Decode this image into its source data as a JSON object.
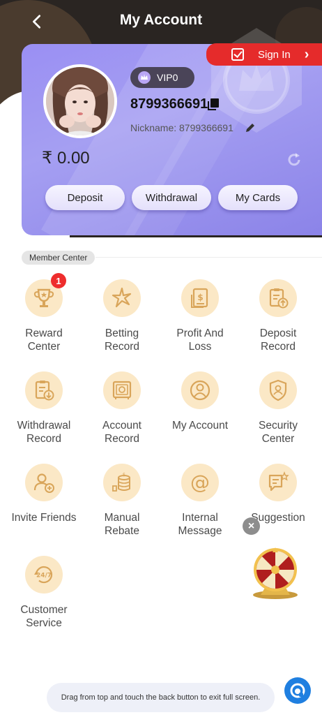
{
  "header": {
    "title": "My Account",
    "back_icon": "chevron-left-icon"
  },
  "profile": {
    "sign_in_label": "Sign In",
    "vip_label": "VIP0",
    "account_id": "8799366691",
    "nickname": "Nickname: 8799366691",
    "balance": "₹ 0.00"
  },
  "actions": [
    {
      "label": "Deposit"
    },
    {
      "label": "Withdrawal"
    },
    {
      "label": "My Cards"
    }
  ],
  "member_center": {
    "label": "Member Center",
    "items": [
      {
        "label_line1": "Reward",
        "label_line2": "Center",
        "icon": "trophy-icon",
        "badge": "1"
      },
      {
        "label_line1": "Betting",
        "label_line2": "Record",
        "icon": "betting-icon"
      },
      {
        "label_line1": "Profit And",
        "label_line2": "Loss",
        "icon": "document-dollar-icon"
      },
      {
        "label_line1": "Deposit",
        "label_line2": "Record",
        "icon": "clipboard-upload-icon"
      },
      {
        "label_line1": "Withdrawal",
        "label_line2": "Record",
        "icon": "clipboard-download-icon"
      },
      {
        "label_line1": "Account",
        "label_line2": "Record",
        "icon": "safe-icon"
      },
      {
        "label_line1": "My Account",
        "label_line2": "",
        "icon": "user-circle-icon"
      },
      {
        "label_line1": "Security",
        "label_line2": "Center",
        "icon": "shield-user-icon"
      },
      {
        "label_line1": "Invite Friends",
        "label_line2": "",
        "icon": "user-add-icon"
      },
      {
        "label_line1": "Manual",
        "label_line2": "Rebate",
        "icon": "coins-icon"
      },
      {
        "label_line1": "Internal",
        "label_line2": "Message",
        "icon": "at-sign-icon"
      },
      {
        "label_line1": "Suggestion",
        "label_line2": "",
        "icon": "chat-star-icon"
      },
      {
        "label_line1": "Customer",
        "label_line2": "Service",
        "icon": "24-7-icon"
      }
    ]
  },
  "toast": {
    "text": "Drag from top and touch the back button to exit full screen."
  },
  "colors": {
    "accent_red": "#e52b2b",
    "card_purple": "#9a8ff3",
    "icon_bg": "#fbe8c6",
    "icon_fg": "#d9a55a",
    "support_blue": "#1f7fe0"
  }
}
